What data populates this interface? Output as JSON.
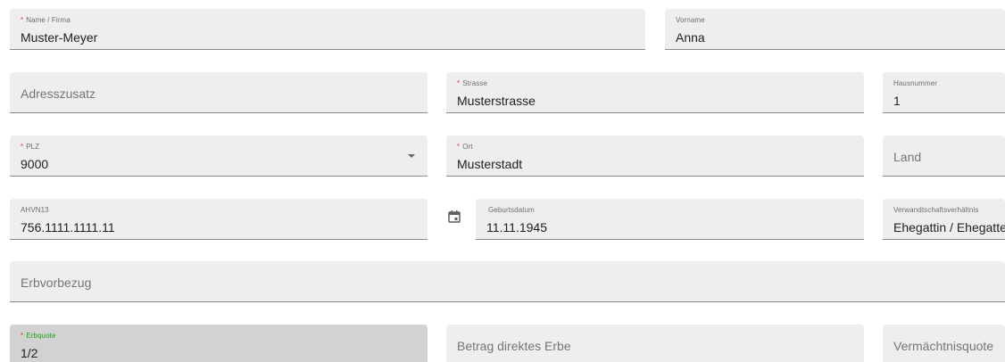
{
  "fields": {
    "name": {
      "label": "Name / Firma",
      "value": "Muster-Meyer"
    },
    "vorname": {
      "label": "Vorname",
      "value": "Anna"
    },
    "adresszusatz": {
      "placeholder": "Adresszusatz"
    },
    "strasse": {
      "label": "Strasse",
      "value": "Musterstrasse"
    },
    "hausnummer": {
      "label": "Hausnummer",
      "value": "1"
    },
    "plz": {
      "label": "PLZ",
      "value": "9000"
    },
    "ort": {
      "label": "Ort",
      "value": "Musterstadt"
    },
    "land": {
      "placeholder": "Land"
    },
    "ahvn13": {
      "label": "AHVN13",
      "value": "756.1111.1111.11"
    },
    "geburtsdatum": {
      "label": "Geburtsdatum",
      "value": "11.11.1945"
    },
    "verwandtschaft": {
      "label": "Verwandtschaftsverhältnis",
      "value": "Ehegattin / Ehegatte"
    },
    "erbvorbezug": {
      "placeholder": "Erbvorbezug"
    },
    "erbquote": {
      "label": "Erbquote",
      "value": "1/2"
    },
    "betrag": {
      "placeholder": "Betrag direktes Erbe"
    },
    "vermaechtnisquote": {
      "placeholder": "Vermächtnisquote"
    }
  },
  "required_marker": "*",
  "icons": {
    "plz_dropdown": "dropdown-arrow-icon",
    "date": "calendar-icon"
  },
  "colors": {
    "required": "#e53935",
    "focus_label": "#18a418"
  }
}
